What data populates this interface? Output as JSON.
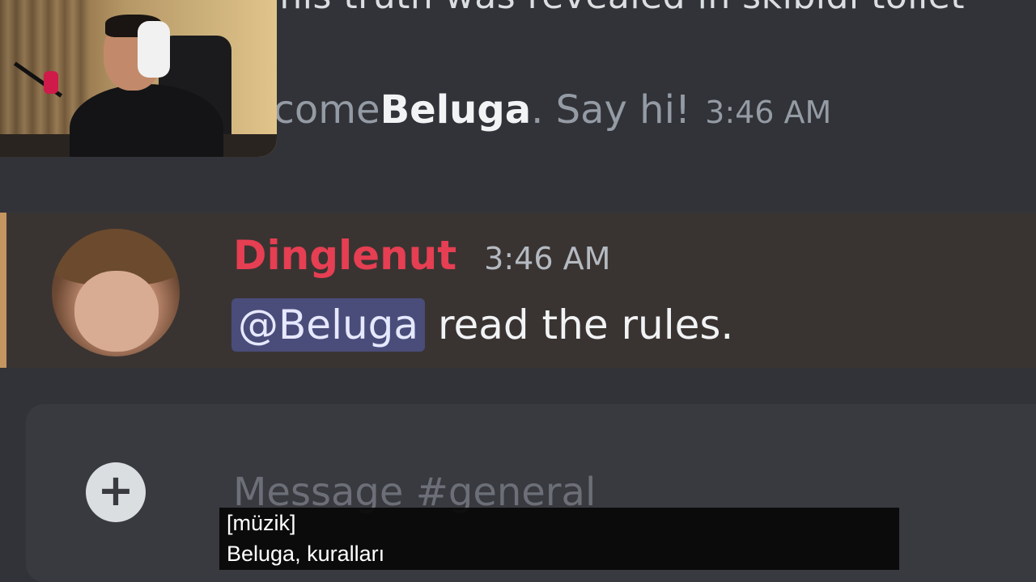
{
  "chat": {
    "top_cut_text": "This truth was revealed in skibidi toilet",
    "join_message": {
      "prefix": "Welcome ",
      "name": "Beluga",
      "suffix": ". Say hi!",
      "time": "3:46 AM"
    },
    "message": {
      "username": "Dinglenut",
      "time": "3:46 AM",
      "mention": "@Beluga",
      "text": "read the rules.",
      "avatar_icon": "avatar"
    }
  },
  "composer": {
    "placeholder": "Message #general",
    "add_icon": "plus-icon"
  },
  "captions": {
    "line1": "[müzik]",
    "line2": "Beluga, kuralları"
  },
  "colors": {
    "background": "#313338",
    "username": "#e63e52",
    "mention_bg": "#4a4c7a",
    "mention_bar": "#c49560"
  }
}
